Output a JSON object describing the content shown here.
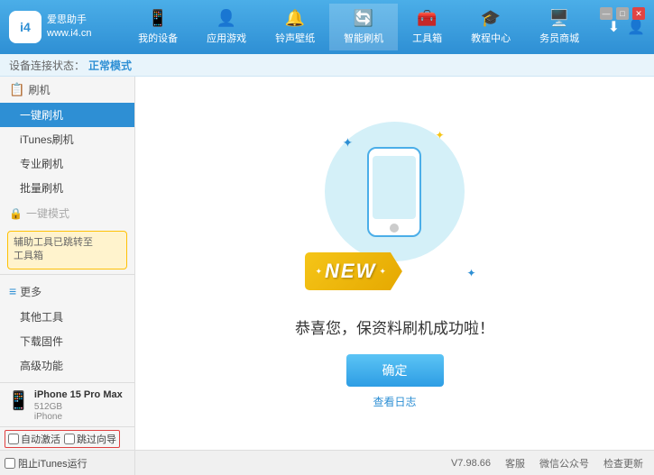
{
  "app": {
    "logo_char": "i4",
    "logo_subtitle": "爱思助手\nwww.i4.cn"
  },
  "nav": {
    "items": [
      {
        "id": "my-device",
        "label": "我的设备",
        "icon": "📱"
      },
      {
        "id": "app-game",
        "label": "应用游戏",
        "icon": "👤"
      },
      {
        "id": "ringtone",
        "label": "铃声壁纸",
        "icon": "🔔"
      },
      {
        "id": "smart-flash",
        "label": "智能刷机",
        "icon": "🔄"
      },
      {
        "id": "toolbox",
        "label": "工具箱",
        "icon": "🧰"
      },
      {
        "id": "tutorial",
        "label": "教程中心",
        "icon": "🎓"
      },
      {
        "id": "business",
        "label": "务员商城",
        "icon": "🖥️"
      }
    ],
    "active": "smart-flash"
  },
  "header_right": {
    "download_icon": "⬇",
    "user_icon": "👤"
  },
  "window_controls": {
    "minimize": "—",
    "maximize": "□",
    "close": "✕"
  },
  "status_bar": {
    "prefix": "设备连接状态：",
    "mode": "正常模式"
  },
  "sidebar": {
    "flash_section": {
      "label": "刷机",
      "items": [
        {
          "id": "one-click-flash",
          "label": "一键刷机",
          "active": true
        },
        {
          "id": "itunes-flash",
          "label": "iTunes刷机",
          "active": false
        },
        {
          "id": "pro-flash",
          "label": "专业刷机",
          "active": false
        },
        {
          "id": "batch-flash",
          "label": "批量刷机",
          "active": false
        }
      ]
    },
    "one-click-restore": {
      "label": "一键模式",
      "disabled": true
    },
    "notice_text": "辅助工具已跳转至\n工具箱",
    "more_section": {
      "label": "更多",
      "items": [
        {
          "id": "other-tools",
          "label": "其他工具"
        },
        {
          "id": "download-firmware",
          "label": "下载固件"
        },
        {
          "id": "advanced",
          "label": "高级功能"
        }
      ]
    }
  },
  "content": {
    "success_message": "恭喜您，保资料刷机成功啦！",
    "confirm_button": "确定",
    "log_link": "查看日志",
    "new_badge": "NEW"
  },
  "footer": {
    "version": "V7.98.66",
    "links": [
      "客服",
      "微信公众号",
      "检查更新"
    ],
    "itunes_checkbox": "阻止iTunes运行"
  },
  "bottom_controls": {
    "auto_activate": "自动激活",
    "guide": "跳过向导"
  },
  "device": {
    "name": "iPhone 15 Pro Max",
    "storage": "512GB",
    "model": "iPhone"
  }
}
